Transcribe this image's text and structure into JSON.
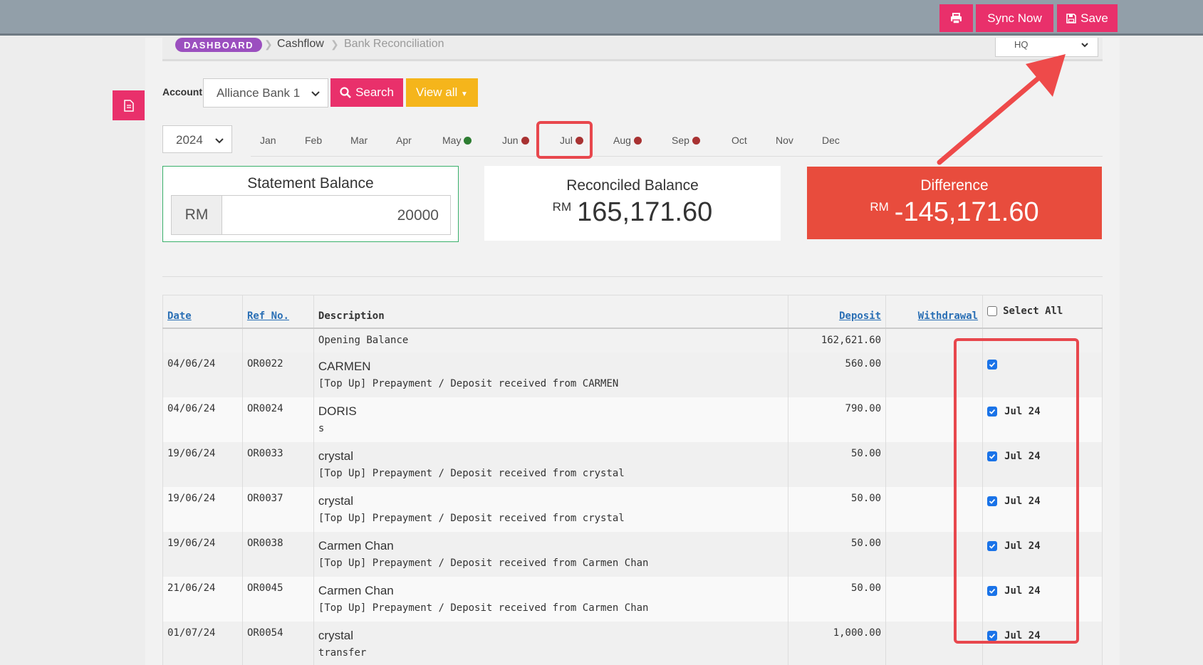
{
  "toolbar": {
    "sync_label": "Sync Now",
    "save_label": "Save"
  },
  "breadcrumb": {
    "items": [
      "DASHBOARD",
      "Cashflow",
      "Bank Reconciliation"
    ],
    "branch": "HQ"
  },
  "filters": {
    "account_label": "Account",
    "account_value": "Alliance Bank 1",
    "search_label": "Search",
    "viewall_label": "View all",
    "year": "2024"
  },
  "months": [
    {
      "label": "Jan",
      "status": "none"
    },
    {
      "label": "Feb",
      "status": "none"
    },
    {
      "label": "Mar",
      "status": "none"
    },
    {
      "label": "Apr",
      "status": "none"
    },
    {
      "label": "May",
      "status": "green"
    },
    {
      "label": "Jun",
      "status": "red"
    },
    {
      "label": "Jul",
      "status": "red"
    },
    {
      "label": "Aug",
      "status": "red"
    },
    {
      "label": "Sep",
      "status": "red"
    },
    {
      "label": "Oct",
      "status": "none"
    },
    {
      "label": "Nov",
      "status": "none"
    },
    {
      "label": "Dec",
      "status": "none"
    }
  ],
  "selected_month": "Jul",
  "statement": {
    "title": "Statement Balance",
    "currency": "RM",
    "value": "20000"
  },
  "reconciled": {
    "title": "Reconciled Balance",
    "currency": "RM",
    "value": "165,171.60"
  },
  "difference": {
    "title": "Difference",
    "currency": "RM",
    "value": "-145,171.60"
  },
  "table": {
    "headers": {
      "date": "Date",
      "ref": "Ref No.",
      "description": "Description",
      "deposit": "Deposit",
      "withdrawal": "Withdrawal",
      "select_all": "Select All"
    },
    "opening": {
      "description": "Opening Balance",
      "deposit": "162,621.60"
    },
    "rows": [
      {
        "date": "04/06/24",
        "ref": "OR0022",
        "name": "CARMEN",
        "sub": "[Top Up] Prepayment / Deposit received from CARMEN",
        "deposit": "560.00",
        "checked": true,
        "period": ""
      },
      {
        "date": "04/06/24",
        "ref": "OR0024",
        "name": "DORIS",
        "sub": "s",
        "deposit": "790.00",
        "checked": true,
        "period": "Jul 24"
      },
      {
        "date": "19/06/24",
        "ref": "OR0033",
        "name": "crystal",
        "sub": "[Top Up] Prepayment / Deposit received from crystal",
        "deposit": "50.00",
        "checked": true,
        "period": "Jul 24"
      },
      {
        "date": "19/06/24",
        "ref": "OR0037",
        "name": "crystal",
        "sub": "[Top Up] Prepayment / Deposit received from crystal",
        "deposit": "50.00",
        "checked": true,
        "period": "Jul 24"
      },
      {
        "date": "19/06/24",
        "ref": "OR0038",
        "name": "Carmen Chan",
        "sub": "[Top Up] Prepayment / Deposit received from Carmen Chan",
        "deposit": "50.00",
        "checked": true,
        "period": "Jul 24"
      },
      {
        "date": "21/06/24",
        "ref": "OR0045",
        "name": "Carmen Chan",
        "sub": "[Top Up] Prepayment / Deposit received from Carmen Chan",
        "deposit": "50.00",
        "checked": true,
        "period": "Jul 24"
      },
      {
        "date": "01/07/24",
        "ref": "OR0054",
        "name": "crystal",
        "sub": "transfer",
        "deposit": "1,000.00",
        "checked": true,
        "period": "Jul 24"
      }
    ]
  },
  "colors": {
    "accent": "#e9306b",
    "warning": "#f5b51b",
    "danger": "#e84c3d",
    "success": "#3ab06b",
    "annotation": "#e8474d"
  }
}
